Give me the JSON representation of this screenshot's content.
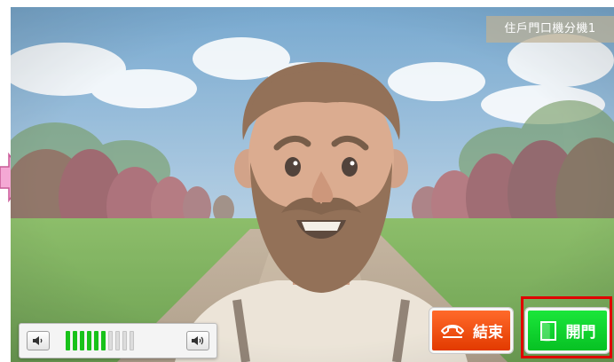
{
  "device_label": "住戶門口機分機1",
  "volume": {
    "level": 6,
    "max": 10,
    "down_icon": "speaker-low-icon",
    "up_icon": "speaker-high-icon",
    "active_color": "#18c21a"
  },
  "actions": {
    "end_call_label": "結束",
    "end_call_icon": "hang-up-icon",
    "end_call_color": "#ff5a1e",
    "open_door_label": "開門",
    "open_door_icon": "door-icon",
    "open_door_color": "#12d42e"
  },
  "highlight_color": "#e00000",
  "indicator_color": "#f4a8d4"
}
